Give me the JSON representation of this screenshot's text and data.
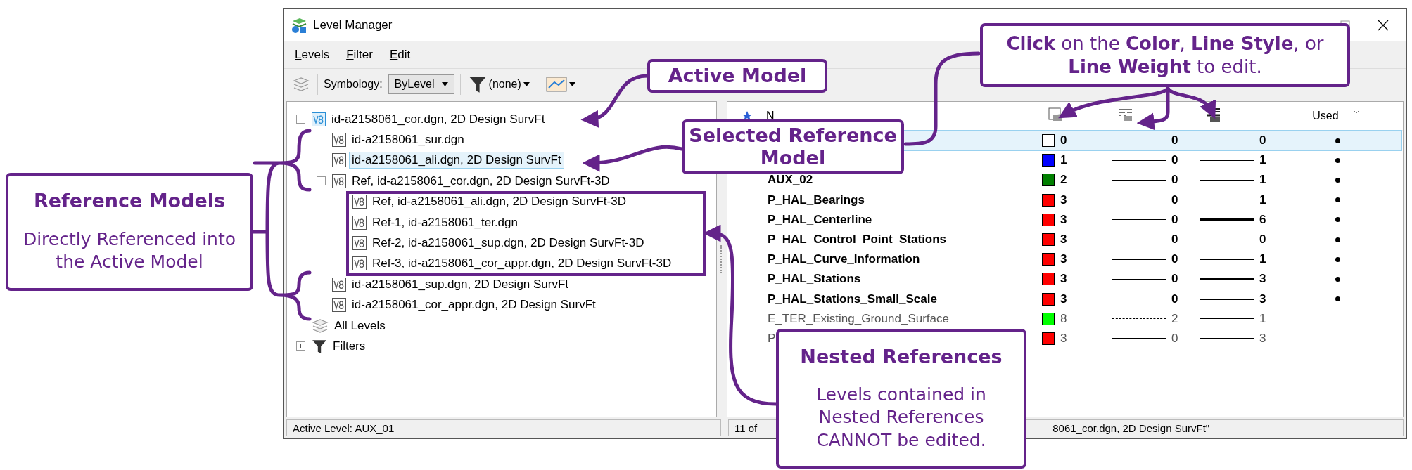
{
  "window": {
    "title": "Level Manager"
  },
  "menu": [
    {
      "label": "Levels"
    },
    {
      "label": "Filter"
    },
    {
      "label": "Edit"
    }
  ],
  "toolbar": {
    "symbology_label": "Symbology:",
    "symbology_value": "ByLevel",
    "filter_value": "(none)"
  },
  "tree": [
    {
      "kind": "model",
      "label": "id-a2158061_cor.dgn, 2D Design SurvFt",
      "active": true,
      "selected": false,
      "expanded": true,
      "children": [
        {
          "kind": "model",
          "label": "id-a2158061_sur.dgn",
          "active": false,
          "selected": false
        },
        {
          "kind": "model",
          "label": "id-a2158061_ali.dgn, 2D Design SurvFt",
          "active": false,
          "selected": true
        },
        {
          "kind": "model",
          "label": "Ref, id-a2158061_cor.dgn, 2D Design SurvFt-3D",
          "active": false,
          "selected": false,
          "expanded": true,
          "children": [
            {
              "kind": "model",
              "label": "Ref, id-a2158061_ali.dgn, 2D Design SurvFt-3D",
              "active": false,
              "selected": false
            },
            {
              "kind": "model",
              "label": "Ref-1, id-a2158061_ter.dgn",
              "active": false,
              "selected": false
            },
            {
              "kind": "model",
              "label": "Ref-2, id-a2158061_sup.dgn, 2D Design SurvFt-3D",
              "active": false,
              "selected": false
            },
            {
              "kind": "model",
              "label": "Ref-3, id-a2158061_cor_appr.dgn, 2D Design SurvFt-3D",
              "active": false,
              "selected": false
            }
          ]
        },
        {
          "kind": "model",
          "label": "id-a2158061_sup.dgn, 2D Design SurvFt",
          "active": false,
          "selected": false
        },
        {
          "kind": "model",
          "label": "id-a2158061_cor_appr.dgn, 2D Design SurvFt",
          "active": false,
          "selected": false
        }
      ]
    },
    {
      "kind": "levels",
      "label": "All Levels",
      "selected": false
    },
    {
      "kind": "filters",
      "label": "Filters",
      "selected": false,
      "expanded": false
    }
  ],
  "table": {
    "columns": [
      {
        "kind": "name",
        "label": "N"
      },
      {
        "kind": "color"
      },
      {
        "kind": "style"
      },
      {
        "kind": "weight"
      },
      {
        "kind": "used",
        "label": "Used"
      }
    ],
    "rows": [
      {
        "selected": true,
        "editable": true,
        "color": "#ffffff",
        "color_number": "0",
        "dashed": false,
        "style": "0",
        "weight": "0",
        "used": true
      },
      {
        "selected": false,
        "editable": true,
        "color": "#0000ff",
        "color_number": "1",
        "dashed": false,
        "style": "0",
        "weight": "1",
        "used": true
      },
      {
        "selected": false,
        "editable": true,
        "name": "AUX_02",
        "color": "#007f00",
        "color_number": "2",
        "dashed": false,
        "style": "0",
        "weight": "1",
        "used": true
      },
      {
        "selected": false,
        "editable": true,
        "name": "P_HAL_Bearings",
        "color": "#ff0000",
        "color_number": "3",
        "dashed": false,
        "style": "0",
        "weight": "1",
        "used": true
      },
      {
        "selected": false,
        "editable": true,
        "name": "P_HAL_Centerline",
        "color": "#ff0000",
        "color_number": "3",
        "dashed": false,
        "style": "0",
        "weight": "6",
        "used": true
      },
      {
        "selected": false,
        "editable": true,
        "name": "P_HAL_Control_Point_Stations",
        "color": "#ff0000",
        "color_number": "3",
        "dashed": false,
        "style": "0",
        "weight": "0",
        "used": true
      },
      {
        "selected": false,
        "editable": true,
        "name": "P_HAL_Curve_Information",
        "color": "#ff0000",
        "color_number": "3",
        "dashed": false,
        "style": "0",
        "weight": "1",
        "used": true
      },
      {
        "selected": false,
        "editable": true,
        "name": "P_HAL_Stations",
        "color": "#ff0000",
        "color_number": "3",
        "dashed": false,
        "style": "0",
        "weight": "3",
        "used": true
      },
      {
        "selected": false,
        "editable": true,
        "name": "P_HAL_Stations_Small_Scale",
        "color": "#ff0000",
        "color_number": "3",
        "dashed": false,
        "style": "0",
        "weight": "3",
        "used": true
      },
      {
        "selected": false,
        "editable": false,
        "name": "E_TER_Existing_Ground_Surface",
        "color": "#00ff00",
        "color_number": "8",
        "dashed": true,
        "style": "2",
        "weight": "1",
        "used": false
      },
      {
        "selected": false,
        "editable": false,
        "name": "P",
        "color": "#ff0000",
        "color_number": "3",
        "dashed": false,
        "style": "0",
        "weight": "3",
        "used": false
      }
    ]
  },
  "status_bar": {
    "left": "Active Level: AUX_01",
    "right": [
      "11 of",
      "8061_cor.dgn, 2D Design SurvFt\""
    ]
  },
  "callouts": [
    {
      "title": "Active Model"
    },
    {
      "text": "**Click** on the **Color**, **Line Style**, or **Line Weight** to edit."
    },
    {
      "title": "Selected Reference Model"
    },
    {
      "title": "Reference Models",
      "body": "Directly Referenced into the Active Model"
    },
    {
      "title": "Nested References",
      "body": "Levels contained in Nested References CANNOT be edited."
    }
  ]
}
